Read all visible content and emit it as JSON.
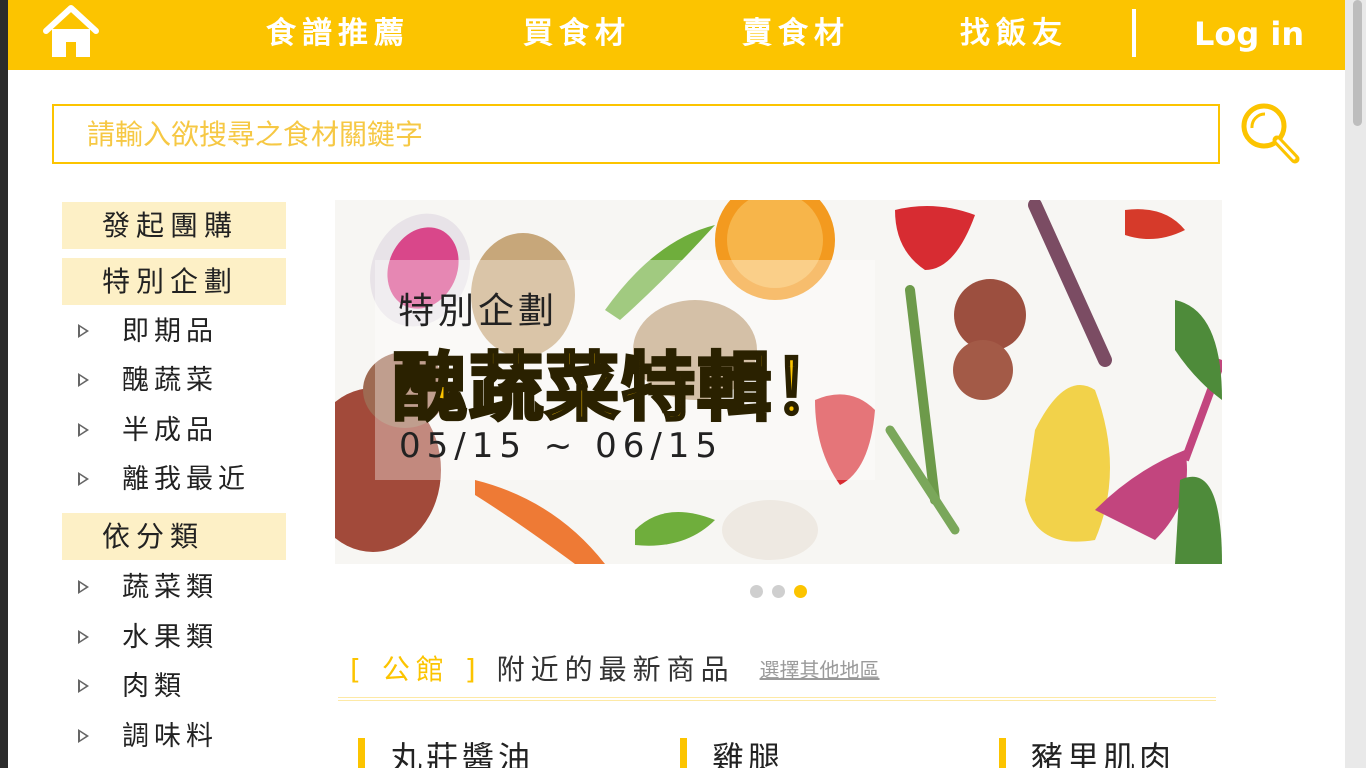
{
  "colors": {
    "accent": "#fcc400",
    "accent_light": "#fdf0c6",
    "text": "#222222",
    "link_muted": "#9a9a9a"
  },
  "header": {
    "home_icon": "home-icon",
    "nav": [
      {
        "label": "食譜推薦"
      },
      {
        "label": "買食材"
      },
      {
        "label": "賣食材"
      },
      {
        "label": "找飯友"
      }
    ],
    "login_label": "Log in"
  },
  "search": {
    "placeholder": "請輸入欲搜尋之食材關鍵字",
    "value": "",
    "icon": "search-icon"
  },
  "sidebar": {
    "group_buy": "發起團購",
    "special": {
      "title": "特別企劃",
      "items": [
        {
          "label": "即期品"
        },
        {
          "label": "醜蔬菜"
        },
        {
          "label": "半成品"
        },
        {
          "label": "離我最近"
        }
      ]
    },
    "category": {
      "title": "依分類",
      "items": [
        {
          "label": "蔬菜類"
        },
        {
          "label": "水果類"
        },
        {
          "label": "肉類"
        },
        {
          "label": "調味料"
        }
      ]
    }
  },
  "banner": {
    "kicker": "特別企劃",
    "title": "醜蔬菜特輯！",
    "date": "05/15 ~ 06/15",
    "slide_count": 3,
    "active_slide": 3
  },
  "nearby": {
    "area_open": "[",
    "area": "公館",
    "area_close": "]",
    "title": "附近的最新商品",
    "change_link": "選擇其他地區"
  },
  "products": [
    {
      "name": "丸莊醬油"
    },
    {
      "name": "雞腿"
    },
    {
      "name": "豬里肌肉"
    }
  ]
}
